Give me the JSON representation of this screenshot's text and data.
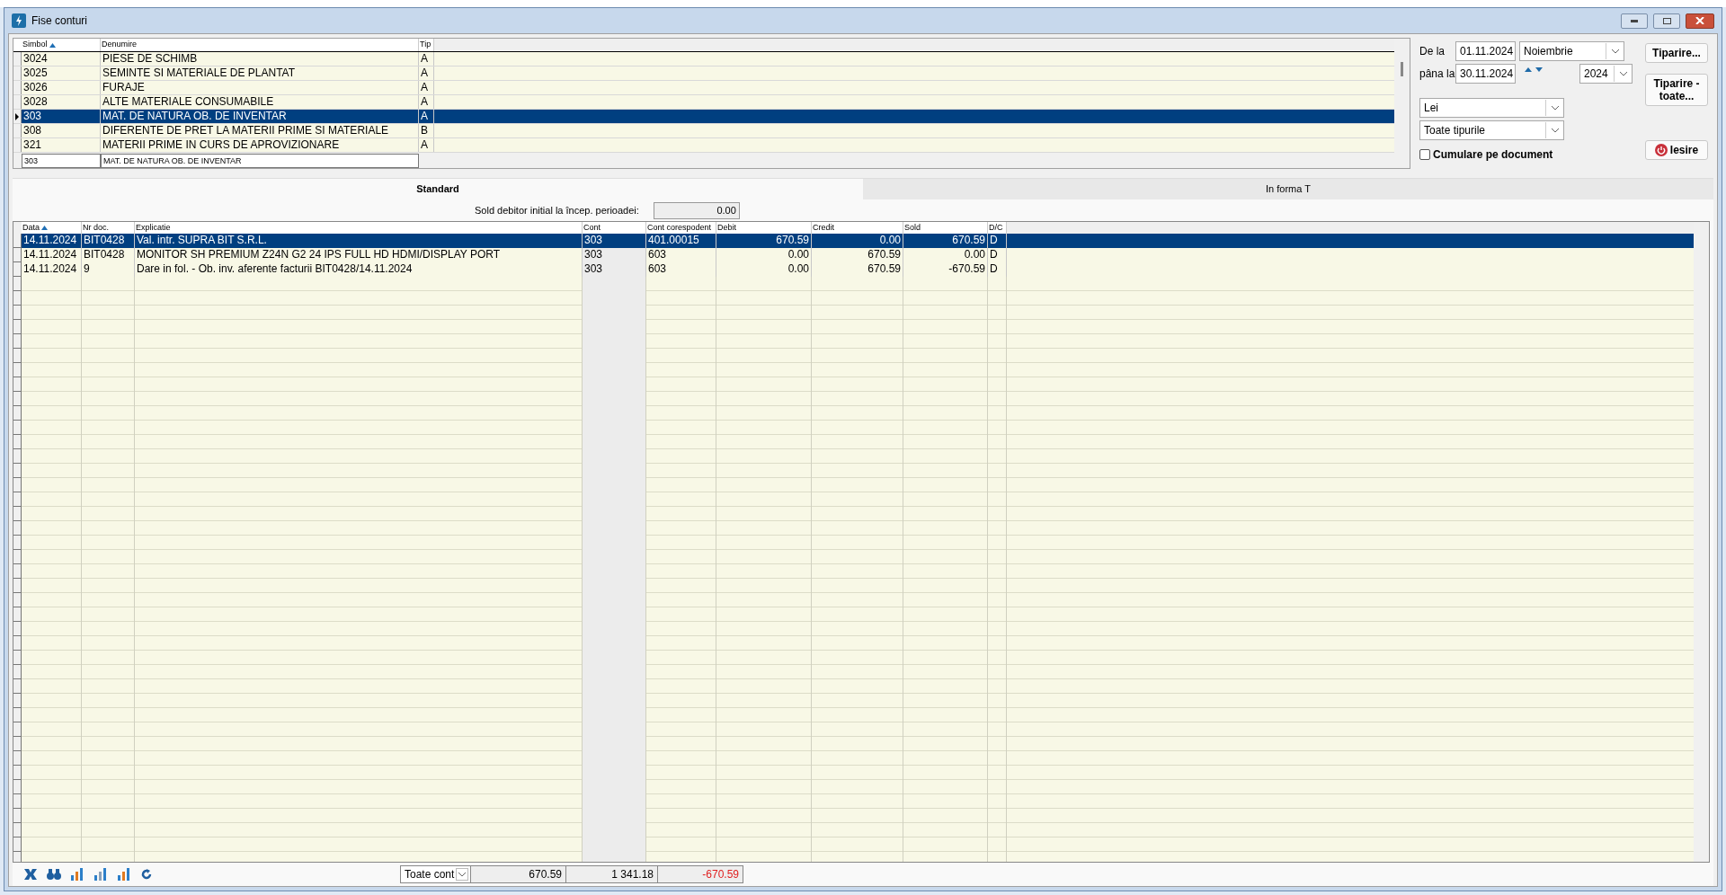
{
  "window": {
    "title": "Fise conturi"
  },
  "accounts": {
    "columns": [
      {
        "label": "Simbol",
        "sorted": true
      },
      {
        "label": "Denumire",
        "sorted": false
      },
      {
        "label": "Tip",
        "sorted": false
      }
    ],
    "rows": [
      {
        "symbol": "3024",
        "name": "PIESE DE SCHIMB",
        "type": "A",
        "selected": false
      },
      {
        "symbol": "3025",
        "name": "SEMINTE SI MATERIALE DE PLANTAT",
        "type": "A",
        "selected": false
      },
      {
        "symbol": "3026",
        "name": "FURAJE",
        "type": "A",
        "selected": false
      },
      {
        "symbol": "3028",
        "name": "ALTE MATERIALE CONSUMABILE",
        "type": "A",
        "selected": false
      },
      {
        "symbol": "303",
        "name": "MAT. DE NATURA OB. DE INVENTAR",
        "type": "A",
        "selected": true
      },
      {
        "symbol": "308",
        "name": "DIFERENTE DE PRET LA MATERII PRIME SI MATERIALE",
        "type": "B",
        "selected": false
      },
      {
        "symbol": "321",
        "name": "MATERII PRIME IN CURS DE APROVIZIONARE",
        "type": "A",
        "selected": false
      }
    ],
    "filter": {
      "symbol": "303",
      "name": "MAT. DE NATURA OB. DE INVENTAR"
    }
  },
  "period": {
    "from_label": "De la",
    "from": "01.11.2024",
    "month": "Noiembrie",
    "to_label": "pâna la",
    "to": "30.11.2024",
    "year": "2024"
  },
  "currency": "Lei",
  "types": "Toate tipurile",
  "cumulate": {
    "label": "Cumulare pe document",
    "checked": false
  },
  "buttons": {
    "print": "Tiparire...",
    "print_all": "Tiparire - toate...",
    "exit": "Iesire"
  },
  "tabs": [
    {
      "label": "Standard",
      "selected": true
    },
    {
      "label": "In forma T",
      "selected": false
    }
  ],
  "opening_balance": {
    "label": "Sold debitor initial la încep. perioadei:",
    "value": "0.00"
  },
  "entries": {
    "columns": [
      {
        "label": "Data",
        "sorted": true
      },
      {
        "label": "Nr doc.",
        "sorted": false
      },
      {
        "label": "Explicatie",
        "sorted": false
      },
      {
        "label": "Cont",
        "sorted": false
      },
      {
        "label": "Cont corespodent",
        "sorted": false
      },
      {
        "label": "Debit",
        "sorted": false
      },
      {
        "label": "Credit",
        "sorted": false
      },
      {
        "label": "Sold",
        "sorted": false
      },
      {
        "label": "D/C",
        "sorted": false
      }
    ],
    "rows": [
      {
        "cells": [
          "14.11.2024",
          "BIT0428",
          "Val. intr. SUPRA BIT S.R.L.",
          "303",
          "401.00015",
          "670.59",
          "0.00",
          "670.59",
          "D"
        ],
        "selected": true
      },
      {
        "cells": [
          "14.11.2024",
          "BIT0428",
          "MONITOR SH PREMIUM Z24N G2 24 IPS FULL HD HDMI/DISPLAY PORT",
          "303",
          "603",
          "0.00",
          "670.59",
          "0.00",
          "D"
        ],
        "selected": false
      },
      {
        "cells": [
          "14.11.2024",
          "9",
          "Dare in fol. - Ob. inv. aferente facturii BIT0428/14.11.2024",
          "303",
          "603",
          "0.00",
          "670.59",
          "-670.59",
          "D"
        ],
        "selected": false
      }
    ]
  },
  "totals": {
    "filter": "Toate cont",
    "debit": "670.59",
    "credit": "1 341.18",
    "balance": "-670.59"
  }
}
